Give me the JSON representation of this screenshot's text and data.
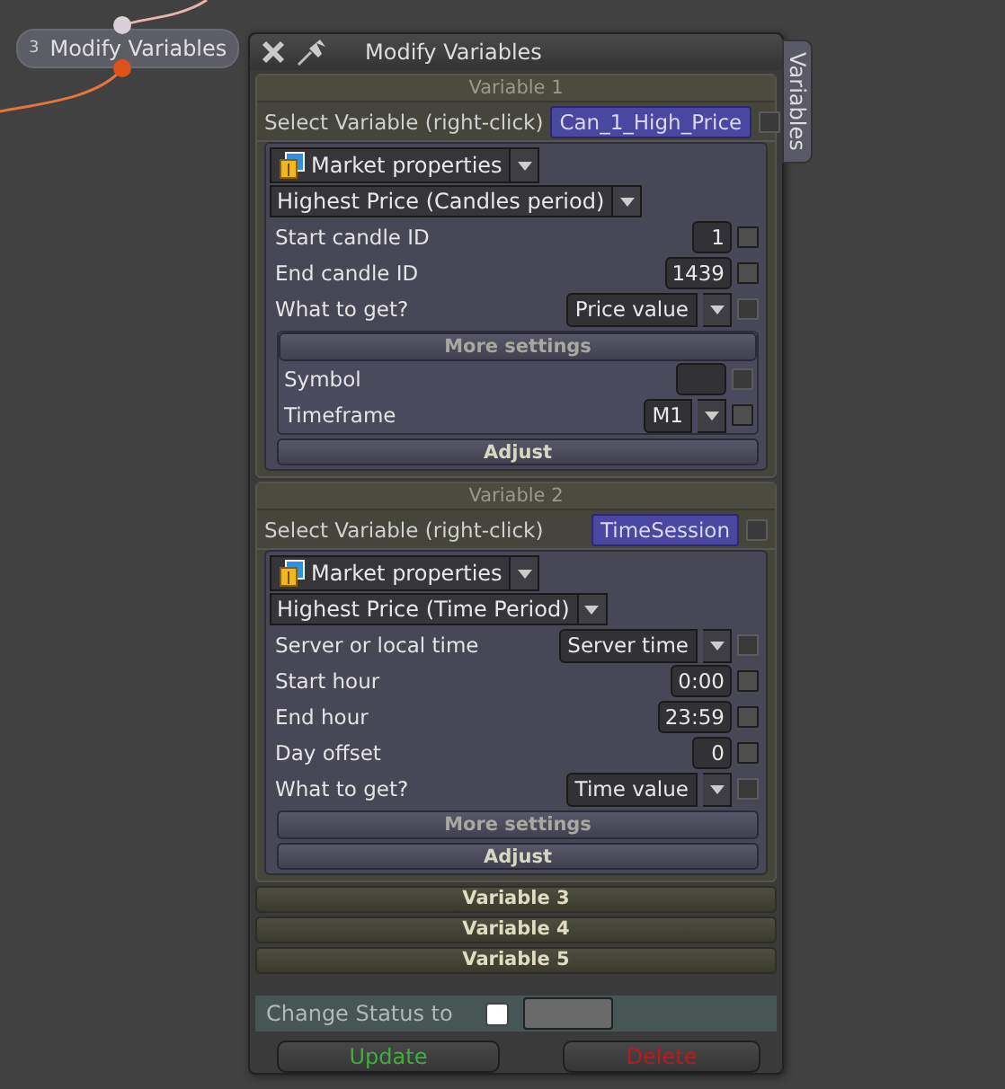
{
  "node": {
    "number": "3",
    "label": "Modify Variables"
  },
  "window": {
    "title": "Modify Variables"
  },
  "side_tab": {
    "label": "Variables"
  },
  "variables": [
    {
      "title": "Variable 1",
      "expanded": true,
      "select_label": "Select Variable (right-click)",
      "select_checkbox_disabled": true,
      "selected_variable": "Can_1_High_Price",
      "category": "Market properties",
      "function": "Highest Price (Candles period)",
      "params": [
        {
          "kind": "number",
          "label": "Start candle ID",
          "value": "1",
          "checkbox_disabled": false
        },
        {
          "kind": "number",
          "label": "End candle ID",
          "value": "1439",
          "checkbox_disabled": false
        },
        {
          "kind": "dropdown",
          "label": "What to get?",
          "value": "Price value",
          "checkbox_disabled": true
        }
      ],
      "more_settings": {
        "label": "More settings",
        "expanded": true,
        "params": [
          {
            "kind": "number",
            "label": "Symbol",
            "checkbox_disabled": true
          },
          {
            "kind": "dropdown",
            "label": "Timeframe",
            "value": "M1",
            "checkbox_disabled": false
          }
        ]
      },
      "adjust": "Adjust"
    },
    {
      "title": "Variable 2",
      "expanded": true,
      "select_label": "Select Variable (right-click)",
      "select_checkbox_disabled": true,
      "selected_variable": "TimeSession",
      "category": "Market properties",
      "function": "Highest Price (Time Period)",
      "params": [
        {
          "kind": "dropdown",
          "label": "Server or local time",
          "value": "Server time",
          "checkbox_disabled": true
        },
        {
          "kind": "number",
          "label": "Start hour",
          "value": "0:00",
          "checkbox_disabled": false
        },
        {
          "kind": "number",
          "label": "End hour",
          "value": "23:59",
          "checkbox_disabled": false
        },
        {
          "kind": "number",
          "label": "Day offset",
          "value": "0",
          "checkbox_disabled": false
        },
        {
          "kind": "dropdown",
          "label": "What to get?",
          "value": "Time value",
          "checkbox_disabled": true
        }
      ],
      "more_settings": {
        "label": "More settings",
        "expanded": false
      },
      "adjust": "Adjust"
    },
    {
      "title": "Variable 3",
      "expanded": false
    },
    {
      "title": "Variable 4",
      "expanded": false
    },
    {
      "title": "Variable 5",
      "expanded": false
    }
  ],
  "status": {
    "label": "Change Status to",
    "checked": false
  },
  "buttons": [
    {
      "kind": "update",
      "label": "Update"
    },
    {
      "kind": "delete",
      "label": "Delete"
    }
  ]
}
